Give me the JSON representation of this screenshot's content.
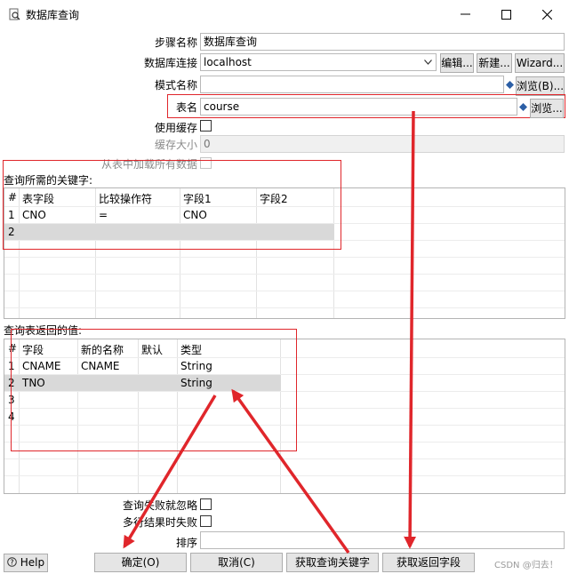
{
  "window": {
    "title": "数据库查询",
    "minimize": "—",
    "maximize": "☐",
    "close": "✕"
  },
  "form": {
    "step_name_label": "步骤名称",
    "step_name_value": "数据库查询",
    "connection_label": "数据库连接",
    "connection_value": "localhost",
    "edit_btn": "编辑...",
    "new_btn": "新建...",
    "wizard_btn": "Wizard...",
    "schema_label": "模式名称",
    "schema_value": "",
    "browse_schema_btn": "浏览(B)...",
    "table_label": "表名",
    "table_value": "course",
    "browse_table_btn": "浏览...",
    "use_cache_label": "使用缓存",
    "cache_size_label": "缓存大小",
    "cache_size_value": "0",
    "load_all_label": "从表中加载所有数据"
  },
  "keys": {
    "section_label": "查询所需的关键字:",
    "columns": [
      "#",
      "表字段",
      "比较操作符",
      "字段1",
      "字段2"
    ],
    "rows": [
      {
        "n": "1",
        "table_field": "CNO",
        "op": "=",
        "field1": "CNO",
        "field2": ""
      },
      {
        "n": "2",
        "table_field": "",
        "op": "",
        "field1": "",
        "field2": ""
      }
    ]
  },
  "returns": {
    "section_label": "查询表返回的值:",
    "columns": [
      "#",
      "字段",
      "新的名称",
      "默认",
      "类型"
    ],
    "rows": [
      {
        "n": "1",
        "field": "CNAME",
        "new_name": "CNAME",
        "default": "",
        "type": "String"
      },
      {
        "n": "2",
        "field": "TNO",
        "new_name": "",
        "default": "",
        "type": "String"
      },
      {
        "n": "3",
        "field": "",
        "new_name": "",
        "default": "",
        "type": ""
      },
      {
        "n": "4",
        "field": "",
        "new_name": "",
        "default": "",
        "type": ""
      }
    ]
  },
  "options": {
    "ignore_fail_label": "查询失败就忽略",
    "multi_fail_label": "多行结果时失败",
    "order_label": "排序",
    "order_value": ""
  },
  "footer": {
    "help": "Help",
    "ok": "确定(O)",
    "cancel": "取消(C)",
    "get_keys": "获取查询关键字",
    "get_fields": "获取返回字段",
    "watermark": "CSDN @归去！"
  },
  "colors": {
    "annotation": "#e0262b",
    "selected_row": "#d9d9d9"
  }
}
